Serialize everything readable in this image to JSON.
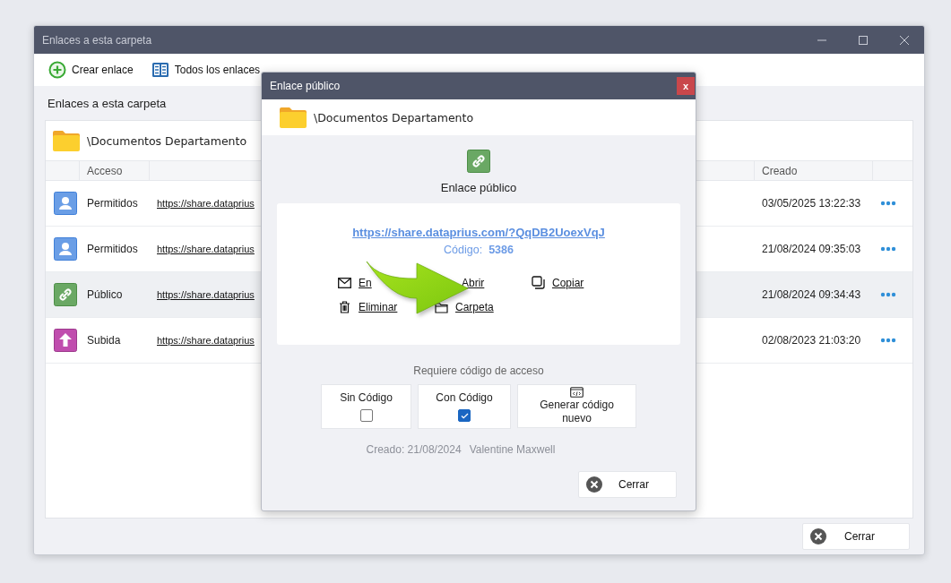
{
  "window": {
    "title": "Enlaces a esta carpeta"
  },
  "toolbar": [
    {
      "kind": "add",
      "label": "Crear enlace"
    },
    {
      "kind": "list",
      "label": "Todos los enlaces"
    }
  ],
  "section_title": "Enlaces a esta carpeta",
  "panel": {
    "folder": "\\Documentos Departamento",
    "columns": {
      "access": "Acceso",
      "created": "Creado"
    },
    "rows": [
      {
        "kind": "users",
        "access": "Permitidos",
        "url": "https://share.dataprius",
        "created": "03/05/2025 13:22:33",
        "selected": false
      },
      {
        "kind": "users",
        "access": "Permitidos",
        "url": "https://share.dataprius",
        "created": "21/08/2024 09:35:03",
        "selected": false
      },
      {
        "kind": "public",
        "access": "Público",
        "url": "https://share.dataprius",
        "created": "21/08/2024 09:34:43",
        "selected": true
      },
      {
        "kind": "upload",
        "access": "Subida",
        "url": "https://share.dataprius",
        "created": "02/08/2023 21:03:20",
        "selected": false
      }
    ]
  },
  "close_button": "Cerrar",
  "dialog": {
    "title": "Enlace público",
    "close": "x",
    "folder": "\\Documentos Departamento",
    "heading": "Enlace público",
    "url": "https://share.dataprius.com/?QqDB2UoexVqJ",
    "code_label": "Código:",
    "code": "5386",
    "actions": [
      {
        "kind": "mail",
        "label": "En"
      },
      {
        "label": "Abrir"
      },
      {
        "kind": "copy",
        "label": "Copiar"
      },
      {
        "kind": "trash",
        "label": "Eliminar"
      },
      {
        "kind": "folder",
        "label": "Carpeta"
      }
    ],
    "access_label": "Requiere código de acceso",
    "options": [
      {
        "kind": "toggle",
        "label": "Sin Código",
        "checked": false
      },
      {
        "kind": "toggle",
        "label": "Con Código",
        "checked": true
      },
      {
        "kind": "generate",
        "label": "Generar código nuevo"
      }
    ],
    "created": "Creado: 21/08/2024",
    "author": "Valentine Maxwell",
    "close_button": "Cerrar"
  }
}
